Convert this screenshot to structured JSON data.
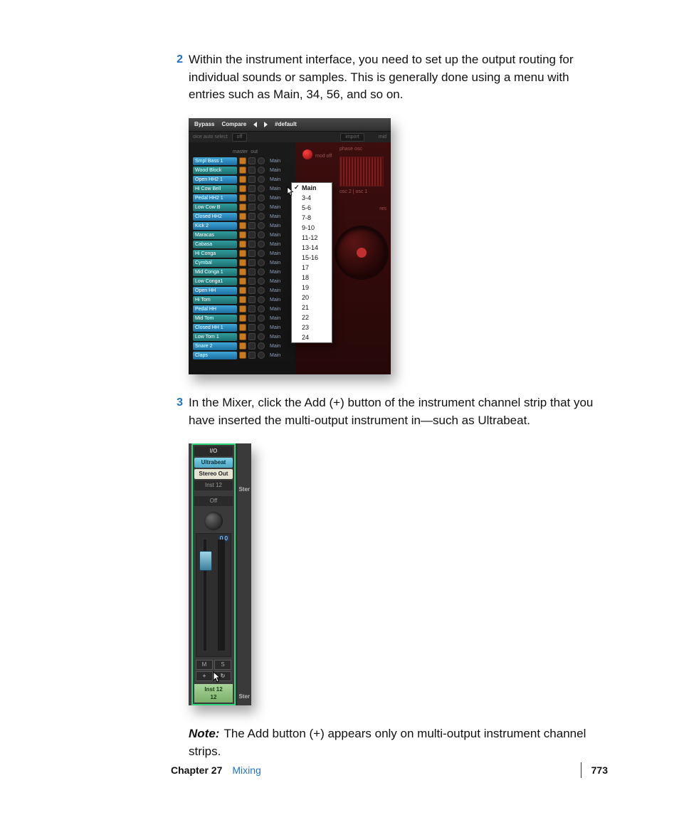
{
  "steps": [
    {
      "num": "2",
      "text": "Within the instrument interface, you need to set up the output routing for individual sounds or samples. This is generally done using a menu with entries such as Main, 34, 56, and so on."
    },
    {
      "num": "3",
      "text": "In the Mixer, click the Add (+) button of the instrument channel strip that you have inserted the multi-output instrument in—such as Ultrabeat."
    }
  ],
  "note": {
    "label": "Note:",
    "text": "The Add button (+) appears only on multi-output instrument channel strips."
  },
  "footer": {
    "chapter": "Chapter 27",
    "title": "Mixing",
    "page": "773"
  },
  "fig1": {
    "topbar": {
      "bypass": "Bypass",
      "compare": "Compare",
      "preset": "#default"
    },
    "subbar": {
      "left": "oice auto select",
      "off": "off",
      "import": "import",
      "right": "mid"
    },
    "list_header": {
      "master": "master",
      "out": "out"
    },
    "out_label": "Main",
    "rows": [
      {
        "name": "Smpl Bass 1",
        "cls": "col-blue"
      },
      {
        "name": "Wood Block",
        "cls": "col-teal"
      },
      {
        "name": "Open HH2 1",
        "cls": "col-blue"
      },
      {
        "name": "Hi Cow Bell",
        "cls": "col-teal"
      },
      {
        "name": "Pedal HH2 1",
        "cls": "col-blue"
      },
      {
        "name": "Low Cow B",
        "cls": "col-teal"
      },
      {
        "name": "Closed HH2",
        "cls": "col-blue"
      },
      {
        "name": "Kick 2",
        "cls": "col-blue"
      },
      {
        "name": "Maracas",
        "cls": "col-teal"
      },
      {
        "name": "Cabasa",
        "cls": "col-teal"
      },
      {
        "name": "Hi Conga",
        "cls": "col-teal"
      },
      {
        "name": "Cymbal",
        "cls": "col-teal"
      },
      {
        "name": "Mid Conga 1",
        "cls": "col-teal"
      },
      {
        "name": "Low Conga1",
        "cls": "col-teal"
      },
      {
        "name": "Open HH",
        "cls": "col-blue"
      },
      {
        "name": "Hi Tom",
        "cls": "col-teal"
      },
      {
        "name": "Pedal HH",
        "cls": "col-blue"
      },
      {
        "name": "Mid Tom",
        "cls": "col-teal"
      },
      {
        "name": "Closed HH 1",
        "cls": "col-blue"
      },
      {
        "name": "Low Tom 1",
        "cls": "col-teal"
      },
      {
        "name": "Snare 2",
        "cls": "col-blue"
      },
      {
        "name": "Claps",
        "cls": "col-blue"
      }
    ],
    "right_labels": {
      "phase": "phase osc",
      "osc": "osc 2 | osc 1",
      "res": "res",
      "mod": "mod off"
    },
    "menu": [
      "Main",
      "3-4",
      "5-6",
      "7-8",
      "9-10",
      "11-12",
      "13-14",
      "15-16",
      "17",
      "18",
      "19",
      "20",
      "21",
      "22",
      "23",
      "24"
    ]
  },
  "fig2": {
    "io": "I/O",
    "ultra": "Ultrabeat",
    "stout": "Stereo Out",
    "inst": "Inst 12",
    "off": "Off",
    "readout": "0.0",
    "m": "M",
    "s": "S",
    "plus": "+",
    "loop": "↻",
    "name1": "Inst 12",
    "name2": "12",
    "side": "Ster"
  }
}
